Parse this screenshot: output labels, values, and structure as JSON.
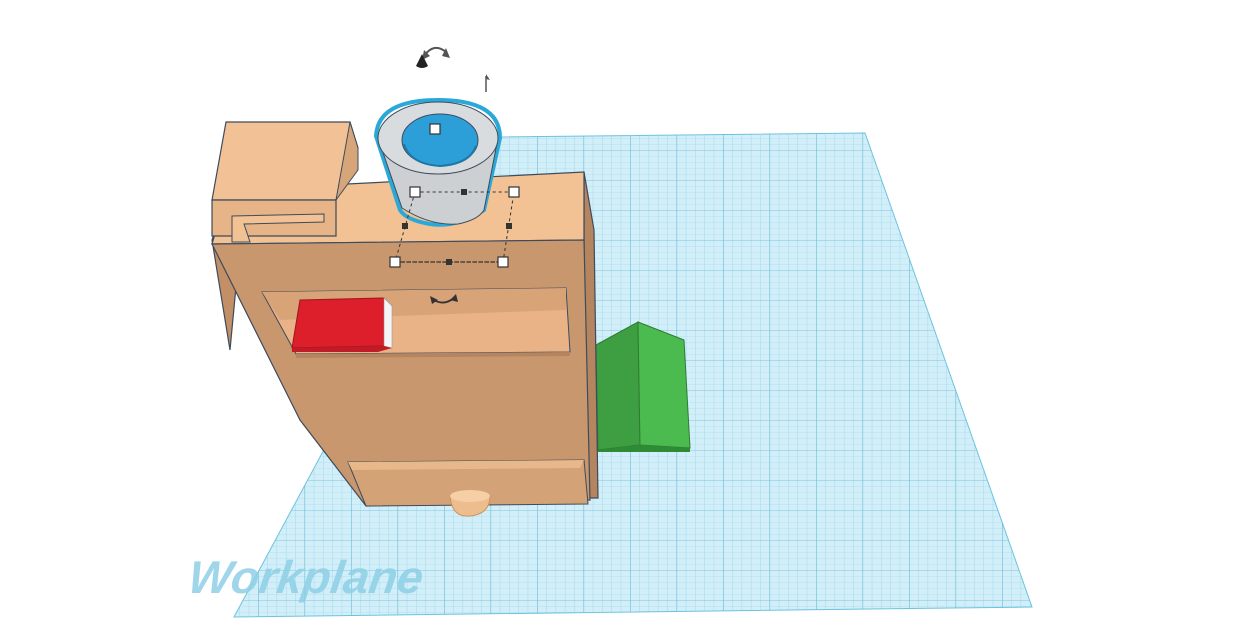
{
  "workplane": {
    "label": "Workplane",
    "grid_color": "#7fc8e0",
    "fill_color": "#d2eef8",
    "label_color": "#8fd0e6"
  },
  "objects": {
    "cabinet": {
      "color": "#c99b74"
    },
    "book": {
      "color": "#dc1f2b"
    },
    "cup": {
      "color": "#c9cccf",
      "inner_color": "#2d9fd8"
    },
    "ramp": {
      "color": "#43b04a"
    },
    "knob": {
      "color": "#eebd8e"
    }
  },
  "icons": {
    "rotate": "rotate-icon",
    "light": "light-cone-icon",
    "lift": "lift-arrow-icon",
    "flip": "flip-rotate-icon"
  },
  "selection": {
    "outline_color": "#2aa9d9",
    "handle_color": "#ffffff"
  }
}
